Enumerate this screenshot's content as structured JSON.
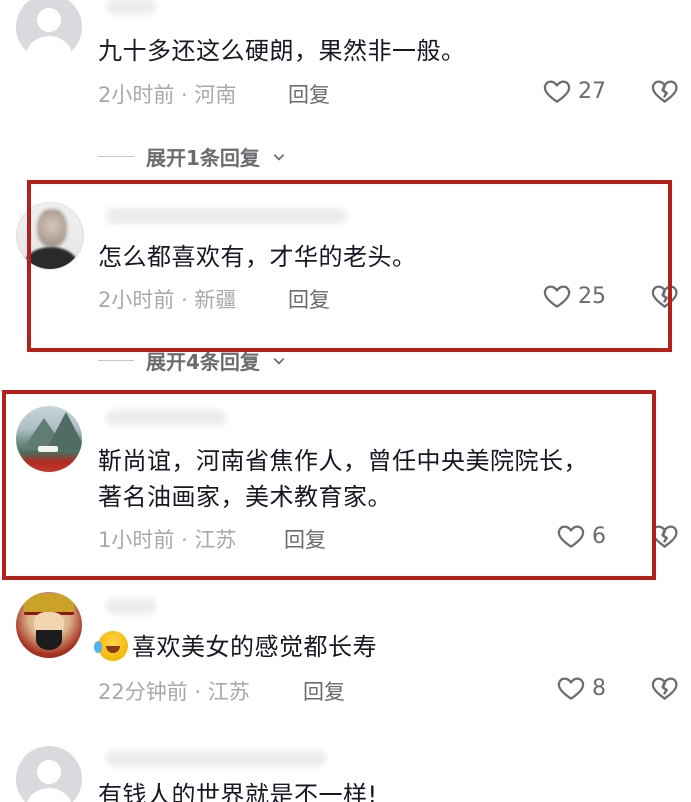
{
  "comments": [
    {
      "text": "九十多还这么硬朗，果然非一般。",
      "time_location": "2小时前 · 河南",
      "reply_label": "回复",
      "likes": "27"
    },
    {
      "text": "怎么都喜欢有，才华的老头。",
      "time_location": "2小时前 · 新疆",
      "reply_label": "回复",
      "likes": "25"
    },
    {
      "text_line1": "靳尚谊，河南省焦作人，曾任中央美院院长，",
      "text_line2": "著名油画家，美术教育家。",
      "time_location": "1小时前 · 江苏",
      "reply_label": "回复",
      "likes": "6"
    },
    {
      "text": "喜欢美女的感觉都长寿",
      "time_location": "22分钟前 · 江苏",
      "reply_label": "回复",
      "likes": "8"
    },
    {
      "text": "有钱人的世界就是不一样!"
    }
  ],
  "expand_replies": [
    "展开1条回复",
    "展开4条回复"
  ],
  "icons": {
    "like": "heart-outline-icon",
    "dislike": "broken-heart-icon",
    "expand": "chevron-down-icon",
    "emoji": "laughing-tears-emoji"
  },
  "colors": {
    "highlight_border": "#b3211a",
    "meta_text": "#a8a8ad",
    "body_text": "#161823"
  }
}
